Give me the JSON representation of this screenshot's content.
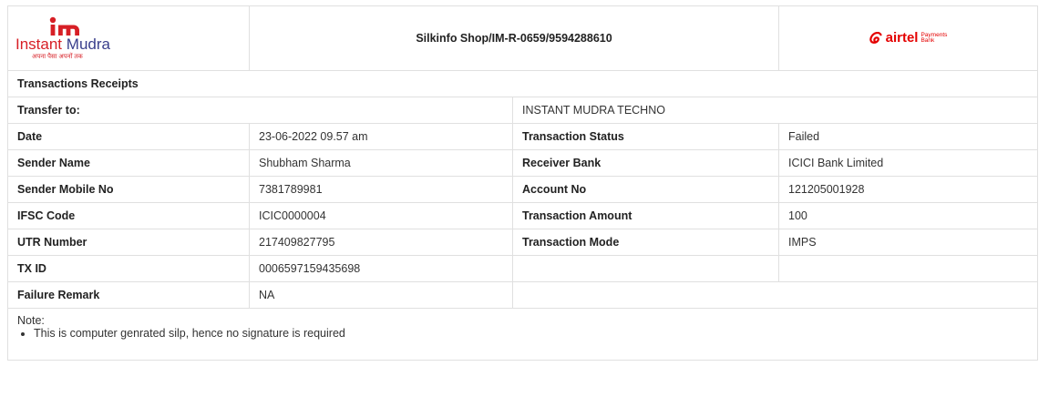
{
  "header": {
    "logo": {
      "word1": "Instant",
      "word2": "Mudra",
      "tagline": "अपना पैसा अपनों तक"
    },
    "shop_id": "Silkinfo Shop/IM-R-0659/9594288610",
    "bank_logo": {
      "word": "airtel",
      "sub1": "Payments",
      "sub2": "Bank"
    }
  },
  "section_title": "Transactions Receipts",
  "transfer_to": {
    "label": "Transfer to:",
    "value": "INSTANT MUDRA TECHNO"
  },
  "rows": [
    {
      "l1": "Date",
      "v1": "23-06-2022 09.57 am",
      "l2": "Transaction Status",
      "v2": "Failed"
    },
    {
      "l1": "Sender Name",
      "v1": "Shubham Sharma",
      "l2": "Receiver Bank",
      "v2": "ICICI Bank Limited"
    },
    {
      "l1": "Sender Mobile No",
      "v1": "7381789981",
      "l2": "Account No",
      "v2": "121205001928"
    },
    {
      "l1": "IFSC Code",
      "v1": "ICIC0000004",
      "l2": "Transaction Amount",
      "v2": "100"
    },
    {
      "l1": "UTR Number",
      "v1": "217409827795",
      "l2": "Transaction Mode",
      "v2": "IMPS"
    },
    {
      "l1": "TX ID",
      "v1": "0006597159435698",
      "l2": "",
      "v2": ""
    }
  ],
  "failure": {
    "label": "Failure Remark",
    "value": "NA"
  },
  "note": {
    "label": "Note:",
    "items": [
      "This is computer genrated silp, hence no signature is required"
    ]
  },
  "colors": {
    "brand_red": "#d71f26",
    "brand_blue": "#3a3f8c",
    "airtel_red": "#e40000",
    "border": "#e0e0e0"
  },
  "icons": {
    "brand_logo": "instant-mudra-logo",
    "bank_logo": "airtel-payments-bank-logo"
  }
}
